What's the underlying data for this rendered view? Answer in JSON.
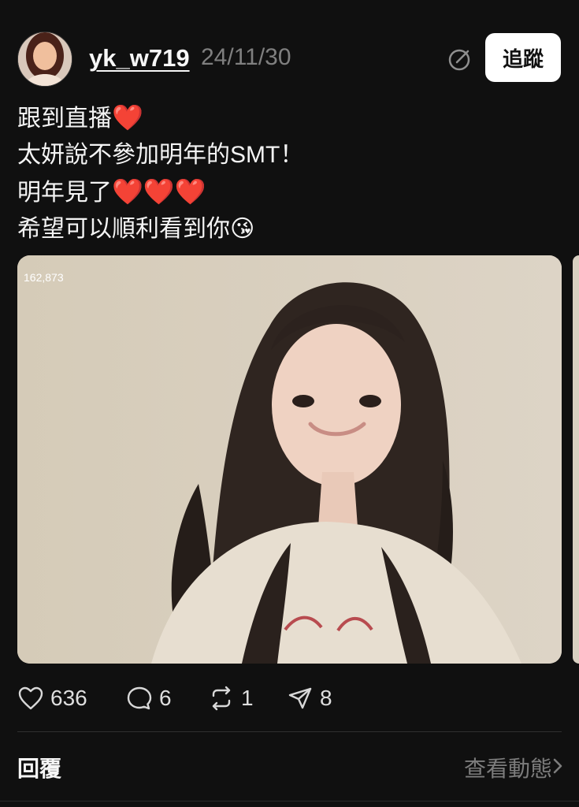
{
  "post": {
    "username": "yk_w719",
    "timestamp": "24/11/30",
    "follow_label": "追蹤",
    "lines": [
      "跟到直播",
      "太妍說不參加明年的SMT！",
      "明年見了",
      "希望可以順利看到你"
    ],
    "emojis": {
      "line1": "❤️",
      "line3": "❤️❤️❤️",
      "line4": "😘"
    },
    "view_count": "162,873"
  },
  "actions": {
    "likes": "636",
    "comments": "6",
    "reposts": "1",
    "shares": "8"
  },
  "footer": {
    "reply_label": "回覆",
    "activity_label": "查看動態"
  }
}
